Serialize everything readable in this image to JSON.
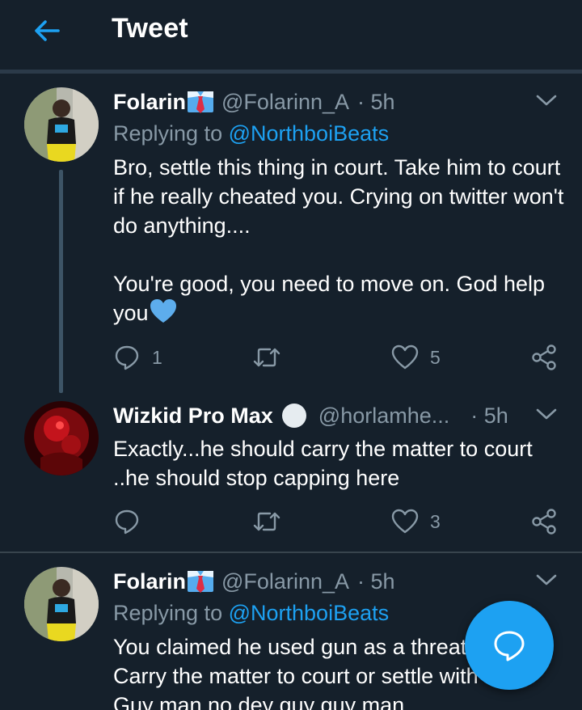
{
  "header": {
    "title": "Tweet"
  },
  "tweets": [
    {
      "name": "Folarin",
      "handle": "@Folarinn_A",
      "time": "· 5h",
      "reply_prefix": "Replying to",
      "reply_handle": "@NorthboiBeats",
      "text": "Bro, settle this thing in court. Take him to court if he really cheated you. Crying on twitter won't do anything....\n\nYou're good, you need to move on. God help you",
      "reply_count": "1",
      "retweet_count": "",
      "like_count": "5"
    },
    {
      "name": "Wizkid Pro Max",
      "handle": "@horlamhe...",
      "time": "· 5h",
      "text": "Exactly...he should carry the matter to court ..he should stop capping here",
      "reply_count": "",
      "retweet_count": "",
      "like_count": "3"
    },
    {
      "name": "Folarin",
      "handle": "@Folarinn_A",
      "time": "· 5h",
      "reply_prefix": "Replying to",
      "reply_handle": "@NorthboiBeats",
      "text": "You claimed he used gun as a threat\nCarry the matter to court or settle with him.\nGuy man no dey guy guy man"
    }
  ],
  "icons": {
    "back": "arrow-left-icon",
    "chevron": "chevron-down-icon",
    "reply": "reply-icon",
    "retweet": "retweet-icon",
    "like": "heart-icon",
    "share": "share-icon",
    "compose": "compose-reply-icon",
    "emoji_tie": "necktie-emoji",
    "emoji_heart": "blue-heart-emoji",
    "emoji_circle": "white-circle-emoji"
  },
  "colors": {
    "background": "#15202b",
    "accent": "#1da1f2",
    "secondary_text": "#8899a6",
    "divider": "#38444d"
  }
}
